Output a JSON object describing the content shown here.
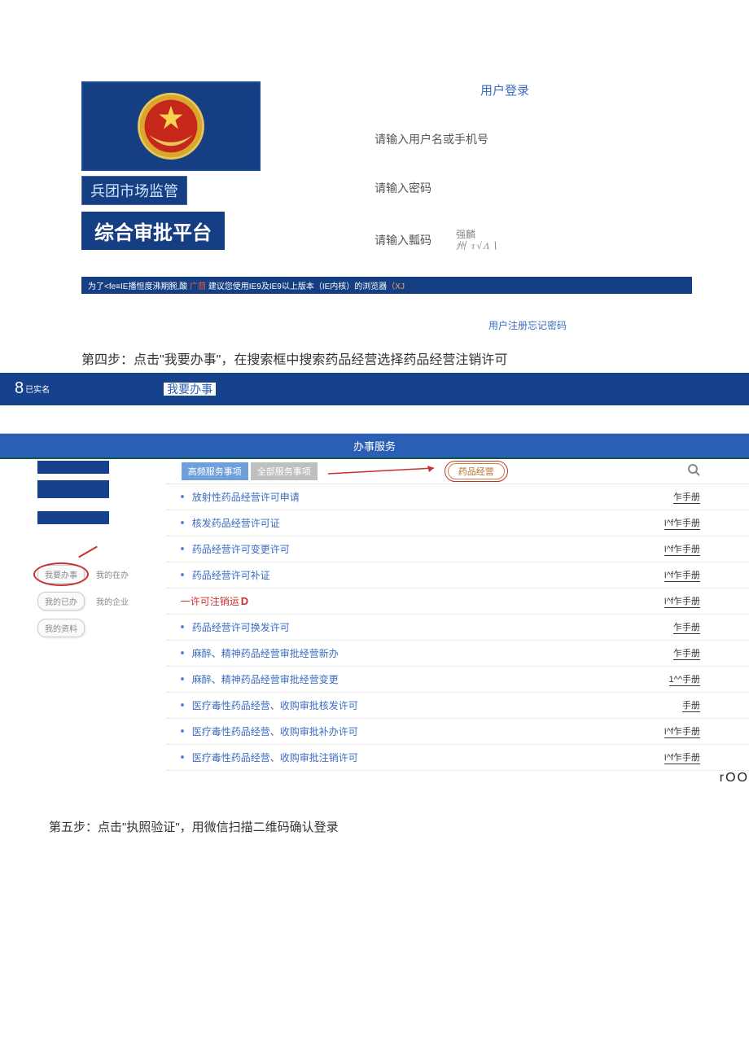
{
  "login": {
    "heading": "用户登录",
    "username_ph": "请输入用户名或手机号",
    "password_ph": "请输入密码",
    "captcha_ph": "请输入瓢码",
    "captcha_hint1": "强麟",
    "captcha_hint2": "州 τ√Λ∖",
    "register": "用户注册",
    "forgot": "忘记密码"
  },
  "brand": {
    "line1": "兵团市场监管",
    "line2": "综合审批平台"
  },
  "notice": {
    "p1": "为了<fe≡IE播怛度沸期腕,酸",
    "p2": " 广茴 ",
    "p3": "建议您使用IE9及IE9以上版本（IE内核）的浏览器",
    "p4": "（XJ"
  },
  "step4": "第四步：点击\"我要办事\"，在搜索框中搜索药品经营选择药品经营注销许可",
  "step5": "第五步：点击\"执照验证\"，用微信扫描二维码确认登录",
  "work": {
    "badge_num": "8",
    "badge_txt": "已实名",
    "tab": "我要办事",
    "service_title": "办事服务",
    "filter_hot": "高频服务事项",
    "filter_all": "全部服务事项",
    "tag": "药品经营",
    "side": {
      "b1": "我要办事",
      "b1r": "我的在办",
      "b2": "我的已办",
      "b2r": "我的企业",
      "b3": "我的资料"
    },
    "items": [
      {
        "title": "放射性药品经营许可申请",
        "manual": "乍手册"
      },
      {
        "title": "核发药品经营许可证",
        "manual": "I^f乍手册"
      },
      {
        "title": "药品经营许可变更许可",
        "manual": "I^f乍手册"
      },
      {
        "title": "药品经营许可补证",
        "manual": "I^f乍手册"
      },
      {
        "title": "一许可注销运",
        "manual": "I^f乍手册",
        "special": true,
        "sq": "D"
      },
      {
        "title": "药品经营许可换发许可",
        "manual": "乍手册"
      },
      {
        "title": "麻醉、精神药品经营审批经营新办",
        "manual": "乍手册"
      },
      {
        "title": "麻醉、精神药品经营审批经营变更",
        "manual": "1^^手册"
      },
      {
        "title": "医疗毒性药品经营、收购审批核发许可",
        "manual": "手册"
      },
      {
        "title": "医疗毒性药品经营、收购审批补办许可",
        "manual": "I^f乍手册"
      },
      {
        "title": "医疗毒性药品经营、收购审批注销许可",
        "manual": "I^f乍手册"
      }
    ],
    "trailing": "rOO"
  }
}
